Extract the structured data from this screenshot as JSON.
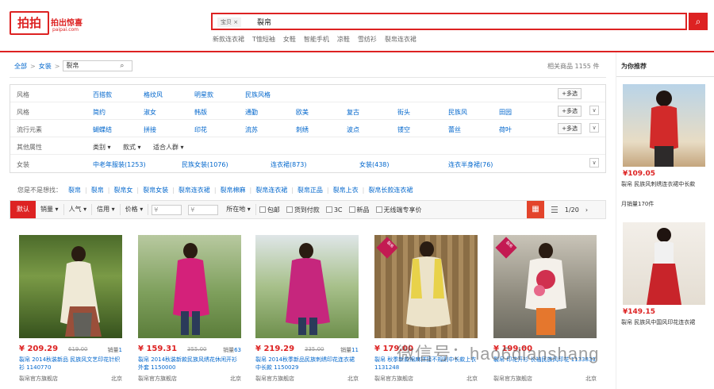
{
  "logo": {
    "main": "拍拍",
    "sub": "拍出惊喜",
    "domain": "paipai.com"
  },
  "search": {
    "scope": "宝贝",
    "scope_x": "×",
    "value": "裂帛",
    "button_icon": "⌕"
  },
  "hot_words": [
    "新款连衣裙",
    "T恤短袖",
    "女鞋",
    "智能手机",
    "凉鞋",
    "雪纺衫",
    "裂帛连衣裙"
  ],
  "breadcrumb": {
    "home": "全部",
    "sep": ">",
    "cat": "女装",
    "query": "裂帛"
  },
  "result_count": "相关商品 1155 件",
  "filters": [
    {
      "label": "风格",
      "options": [
        "百搭款",
        "格纹风",
        "明星款",
        "民族风格"
      ],
      "more": "",
      "expand": ""
    },
    {
      "label": "风格",
      "options": [
        "简约",
        "淑女",
        "韩版",
        "通勤",
        "欧美",
        "复古",
        "街头",
        "民族风",
        "田园"
      ],
      "more": "+多选",
      "expand": "∨"
    },
    {
      "label": "流行元素",
      "options": [
        "蝴蝶结",
        "拼接",
        "印花",
        "流苏",
        "刺绣",
        "波点",
        "镂空",
        "蕾丝",
        "荷叶"
      ],
      "more": "+多选",
      "expand": "∨"
    },
    {
      "label": "其他属性",
      "options": [
        "类别 ▾",
        "款式 ▾",
        "适合人群 ▾"
      ],
      "more": "",
      "expand": ""
    },
    {
      "label": "女装",
      "options": [
        "中老年服装(1253)",
        "民族女装(1076)",
        "连衣裙(873)",
        "女装(438)",
        "连衣半身裙(76)"
      ],
      "more": "",
      "expand": "∨"
    }
  ],
  "related": {
    "label": "您是不是想找：",
    "items": [
      "裂帛",
      "裂帛",
      "裂帛女",
      "裂帛女装",
      "裂帛连衣裙",
      "裂帛棉麻",
      "裂帛连衣裙",
      "裂帛正品",
      "裂帛上衣",
      "裂帛长款连衣裙"
    ]
  },
  "sortbar": {
    "default": "默认",
    "sorts": [
      "销量 ▾",
      "人气 ▾",
      "信用 ▾",
      "价格 ▾"
    ],
    "price_from": "¥",
    "price_to": "¥",
    "location": "所在地 ▾",
    "checks": [
      "包邮",
      "货到付款",
      "3C",
      "新品",
      "无线端专享价"
    ],
    "grid_icon": "▦",
    "list_icon": "☰",
    "page": "1/20",
    "next": "›"
  },
  "products": [
    {
      "price": "¥ 209.29",
      "orig": "619.00",
      "sold_label": "销量",
      "sold": "1",
      "title": "裂帛 2014秋装新品 民族风文艺印花针织衫 1140770",
      "seller": "裂帛官方旗舰店",
      "loc": "北京",
      "badge": ""
    },
    {
      "price": "¥ 159.31",
      "orig": "355.00",
      "sold_label": "销量",
      "sold": "63",
      "title": "裂帛 2014秋装新款民族风绣花休闲开衫外套 1150000",
      "seller": "裂帛官方旗舰店",
      "loc": "北京",
      "badge": ""
    },
    {
      "price": "¥ 219.29",
      "orig": "335.00",
      "sold_label": "销量",
      "sold": "11",
      "title": "裂帛 2014秋季新品民族刺绣印花连衣裙中长款 1150029",
      "seller": "裂帛官方旗舰店",
      "loc": "北京",
      "badge": ""
    },
    {
      "price": "¥ 179.00",
      "orig": "",
      "sold_label": "",
      "sold": "",
      "title": "裂帛 秋季新款棉麻拼接不规则中长款上衣 1131248",
      "seller": "裂帛官方旗舰店",
      "loc": "北京",
      "badge": "裂帛"
    },
    {
      "price": "¥ 199.00",
      "orig": "",
      "sold_label": "",
      "sold": "",
      "title": "裂帛 印花开衫 长袖民族风印花 1133833",
      "seller": "裂帛官方旗舰店",
      "loc": "北京",
      "badge": "裂帛"
    }
  ],
  "sidebar": {
    "title": "为你推荐",
    "items": [
      {
        "price": "¥109.05",
        "title": "裂帛 民族风刺绣连衣裙中长款",
        "sub": "月销量170件"
      },
      {
        "price": "¥149.15",
        "title": "裂帛 民族风中国风印花连衣裙",
        "sub": ""
      }
    ]
  },
  "watermark": "微信号：hao6dianshang",
  "colors": {
    "accent": "#dd2222",
    "link": "#0066cc"
  }
}
